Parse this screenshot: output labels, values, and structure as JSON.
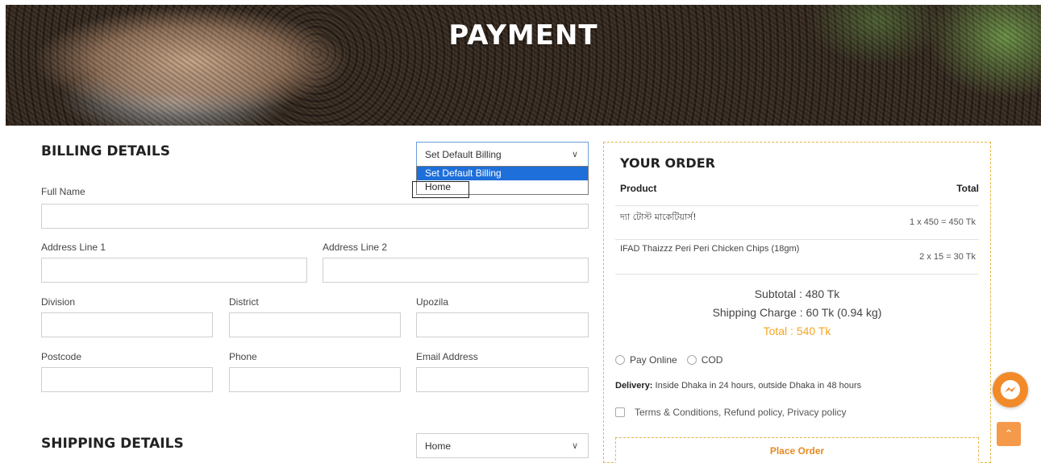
{
  "banner": {
    "title": "PAYMENT"
  },
  "billing": {
    "title": "BILLING DETAILS",
    "select_value": "Set Default Billing",
    "options": [
      "Set Default Billing",
      "Home"
    ],
    "labels": {
      "full_name": "Full Name",
      "address1": "Address Line 1",
      "address2": "Address Line 2",
      "division": "Division",
      "district": "District",
      "upozila": "Upozila",
      "postcode": "Postcode",
      "phone": "Phone",
      "email": "Email Address"
    }
  },
  "shipping": {
    "title": "SHIPPING DETAILS",
    "select_value": "Home"
  },
  "order": {
    "title": "YOUR ORDER",
    "col_product": "Product",
    "col_total": "Total",
    "items": [
      {
        "name": "দ্যা টোস্ট মাকেটিয়ার্স!",
        "total": "1 x 450 = 450 Tk"
      },
      {
        "name": "IFAD Thaizzz Peri Peri Chicken Chips (18gm)",
        "total": "2 x 15 = 30 Tk"
      }
    ],
    "subtotal": "Subtotal : 480 Tk",
    "shipping_charge": "Shipping Charge : 60 Tk (0.94 kg)",
    "total": "Total : 540 Tk",
    "payment_options": [
      "Pay Online",
      "COD"
    ],
    "delivery_label": "Delivery:",
    "delivery_text": "Inside Dhaka in 24 hours, outside Dhaka in 48 hours",
    "terms": "Terms & Conditions, Refund policy, Privacy policy",
    "place_order": "Place Order"
  },
  "colors": {
    "accent": "#f5a623",
    "select_highlight": "#1e6fd9",
    "messenger": "#f28a2a"
  },
  "icons": {
    "messenger": "messenger-icon",
    "to_top": "chevron-up-icon",
    "select": "chevron-down-icon"
  }
}
